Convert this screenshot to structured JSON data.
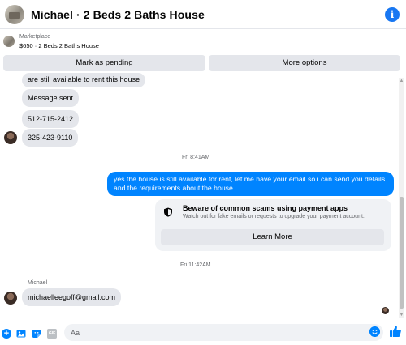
{
  "header": {
    "title": "Michael · 2 Beds 2 Baths House",
    "avatar_icon": "house-photo",
    "info_icon": "info-icon"
  },
  "marketplace": {
    "label": "Marketplace",
    "item": "$650 · 2 Beds 2 Baths House"
  },
  "actions": {
    "pending": "Mark as pending",
    "more": "More options"
  },
  "messages": {
    "partial": "are still available to rent this house",
    "sent": "Message sent",
    "phone1": "512-715-2412",
    "phone2": "325-423-9110",
    "time1": "Fri 8:41AM",
    "reply": "yes the house is still available for rent, let me have your email  so i can send you details and the requirements about the house",
    "time2": "Fri 11:42AM",
    "sender_name": "Michael",
    "email": "michaelleegoff@gmail.com"
  },
  "scam_notice": {
    "title": "Beware of common scams using payment apps",
    "description": "Watch out for fake emails or requests to upgrade your payment account.",
    "button": "Learn More"
  },
  "composer": {
    "placeholder": "Aa"
  },
  "colors": {
    "accent": "#0084ff",
    "info_blue": "#1877f2",
    "incoming_bubble": "#e4e6eb",
    "card_bg": "#f0f2f5"
  }
}
